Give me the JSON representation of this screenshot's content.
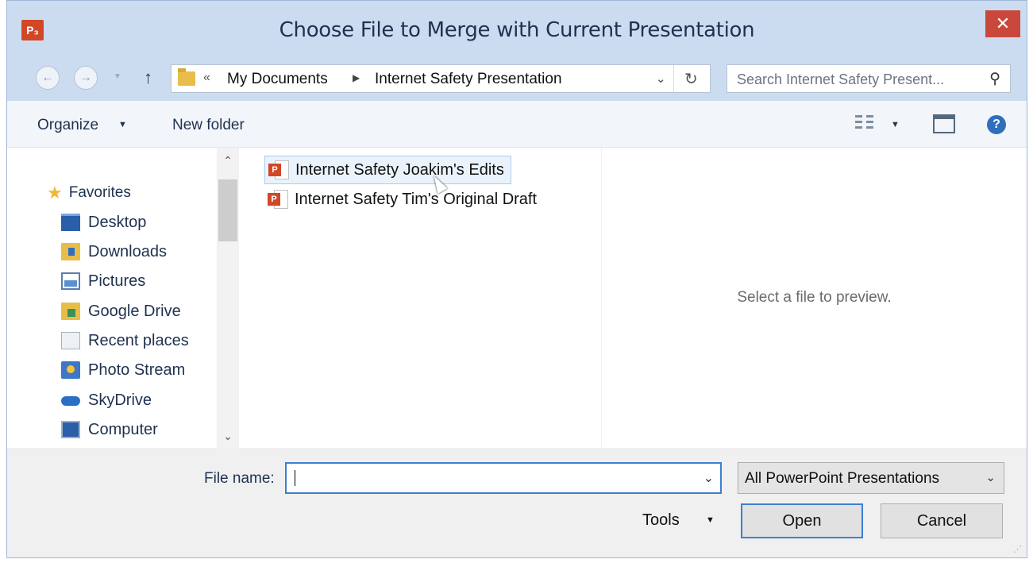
{
  "window": {
    "title": "Choose File to Merge with Current Presentation",
    "app_icon_text": "P₃",
    "close_glyph": "✕"
  },
  "navigation": {
    "back_glyph": "←",
    "forward_glyph": "→",
    "up_glyph": "↑",
    "address": {
      "overflow": "«",
      "segments": [
        "My Documents",
        "Internet Safety Presentation"
      ]
    },
    "search_placeholder": "Search Internet Safety Present..."
  },
  "toolbar": {
    "organize_label": "Organize",
    "new_folder_label": "New folder"
  },
  "sidebar": {
    "favorites_label": "Favorites",
    "items": [
      {
        "label": "Desktop",
        "icon": "desktop-icon"
      },
      {
        "label": "Downloads",
        "icon": "downloads-folder-icon"
      },
      {
        "label": "Pictures",
        "icon": "pictures-icon"
      },
      {
        "label": "Google Drive",
        "icon": "google-drive-folder-icon"
      },
      {
        "label": "Recent places",
        "icon": "recent-places-icon"
      },
      {
        "label": "Photo Stream",
        "icon": "photo-stream-icon"
      },
      {
        "label": "SkyDrive",
        "icon": "skydrive-icon"
      },
      {
        "label": "Computer",
        "icon": "computer-icon"
      }
    ]
  },
  "files": [
    {
      "name": "Internet Safety Joakim's Edits",
      "icon": "powerpoint-file-icon",
      "hovered": true
    },
    {
      "name": "Internet Safety Tim's Original Draft",
      "icon": "powerpoint-file-icon",
      "hovered": false
    }
  ],
  "preview": {
    "message": "Select a file to preview."
  },
  "footer": {
    "file_name_label": "File name:",
    "file_name_value": "",
    "file_type": "All PowerPoint Presentations",
    "tools_label": "Tools",
    "open_label": "Open",
    "cancel_label": "Cancel"
  },
  "colors": {
    "frame": "#ccdcf0",
    "close_button": "#c9483b",
    "powerpoint": "#d24726",
    "focus_border": "#3c7fd1"
  }
}
